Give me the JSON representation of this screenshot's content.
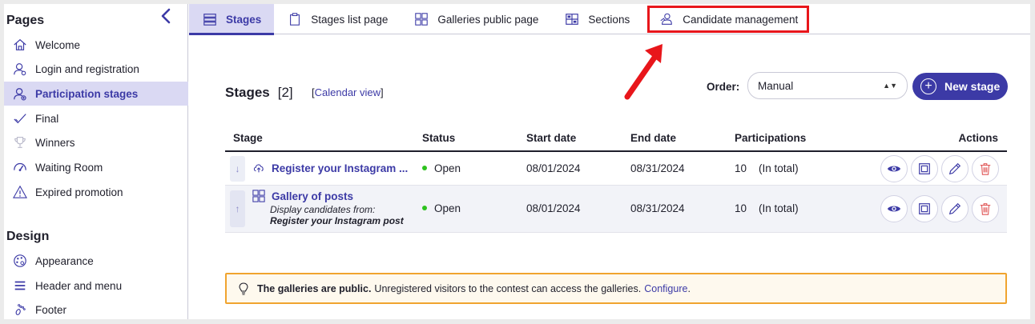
{
  "sidebar": {
    "pages_title": "Pages",
    "pages_items": [
      {
        "label": "Welcome",
        "icon": "home-icon"
      },
      {
        "label": "Login and registration",
        "icon": "user-login-icon"
      },
      {
        "label": "Participation stages",
        "icon": "participation-icon",
        "active": true
      },
      {
        "label": "Final",
        "icon": "check-icon"
      },
      {
        "label": "Winners",
        "icon": "trophy-icon"
      },
      {
        "label": "Waiting Room",
        "icon": "gauge-icon"
      },
      {
        "label": "Expired promotion",
        "icon": "warning-icon"
      }
    ],
    "design_title": "Design",
    "design_items": [
      {
        "label": "Appearance",
        "icon": "palette-icon"
      },
      {
        "label": "Header and menu",
        "icon": "menu-icon"
      },
      {
        "label": "Footer",
        "icon": "footer-icon"
      }
    ]
  },
  "tabs": [
    {
      "label": "Stages",
      "icon": "stages-icon",
      "active": true
    },
    {
      "label": "Stages list page",
      "icon": "clipboard-icon"
    },
    {
      "label": "Galleries public page",
      "icon": "grid-icon"
    },
    {
      "label": "Sections",
      "icon": "sections-icon"
    },
    {
      "label": "Candidate management",
      "icon": "candidate-icon",
      "highlighted": true
    }
  ],
  "main": {
    "title": "Stages",
    "count": "[2]",
    "calendar_open": "[",
    "calendar_link": "Calendar view",
    "calendar_close": "]",
    "order_label": "Order:",
    "order_value": "Manual",
    "new_stage_label": "New stage"
  },
  "table": {
    "headers": {
      "stage": "Stage",
      "status": "Status",
      "start": "Start date",
      "end": "End date",
      "participations": "Participations",
      "actions": "Actions"
    },
    "rows": [
      {
        "move": "↓",
        "name": "Register your Instagram ...",
        "status": "Open",
        "start": "08/01/2024",
        "end": "08/31/2024",
        "participations": "10",
        "participations_note": "(In total)"
      },
      {
        "move": "↑",
        "name": "Gallery of posts",
        "sub_prefix": "Display candidates from:",
        "sub_source": "Register your Instagram post",
        "status": "Open",
        "start": "08/01/2024",
        "end": "08/31/2024",
        "participations": "10",
        "participations_note": "(In total)"
      }
    ]
  },
  "notice": {
    "bold": "The galleries are public.",
    "text": "Unregistered visitors to the contest can access the galleries.",
    "link": "Configure",
    "end": "."
  },
  "colors": {
    "accent": "#3c3aa6",
    "active_bg": "#dad9f3",
    "highlight": "#e8161b",
    "status_open": "#2ec21f",
    "delete": "#e05656",
    "notice_border": "#f0a42f"
  }
}
